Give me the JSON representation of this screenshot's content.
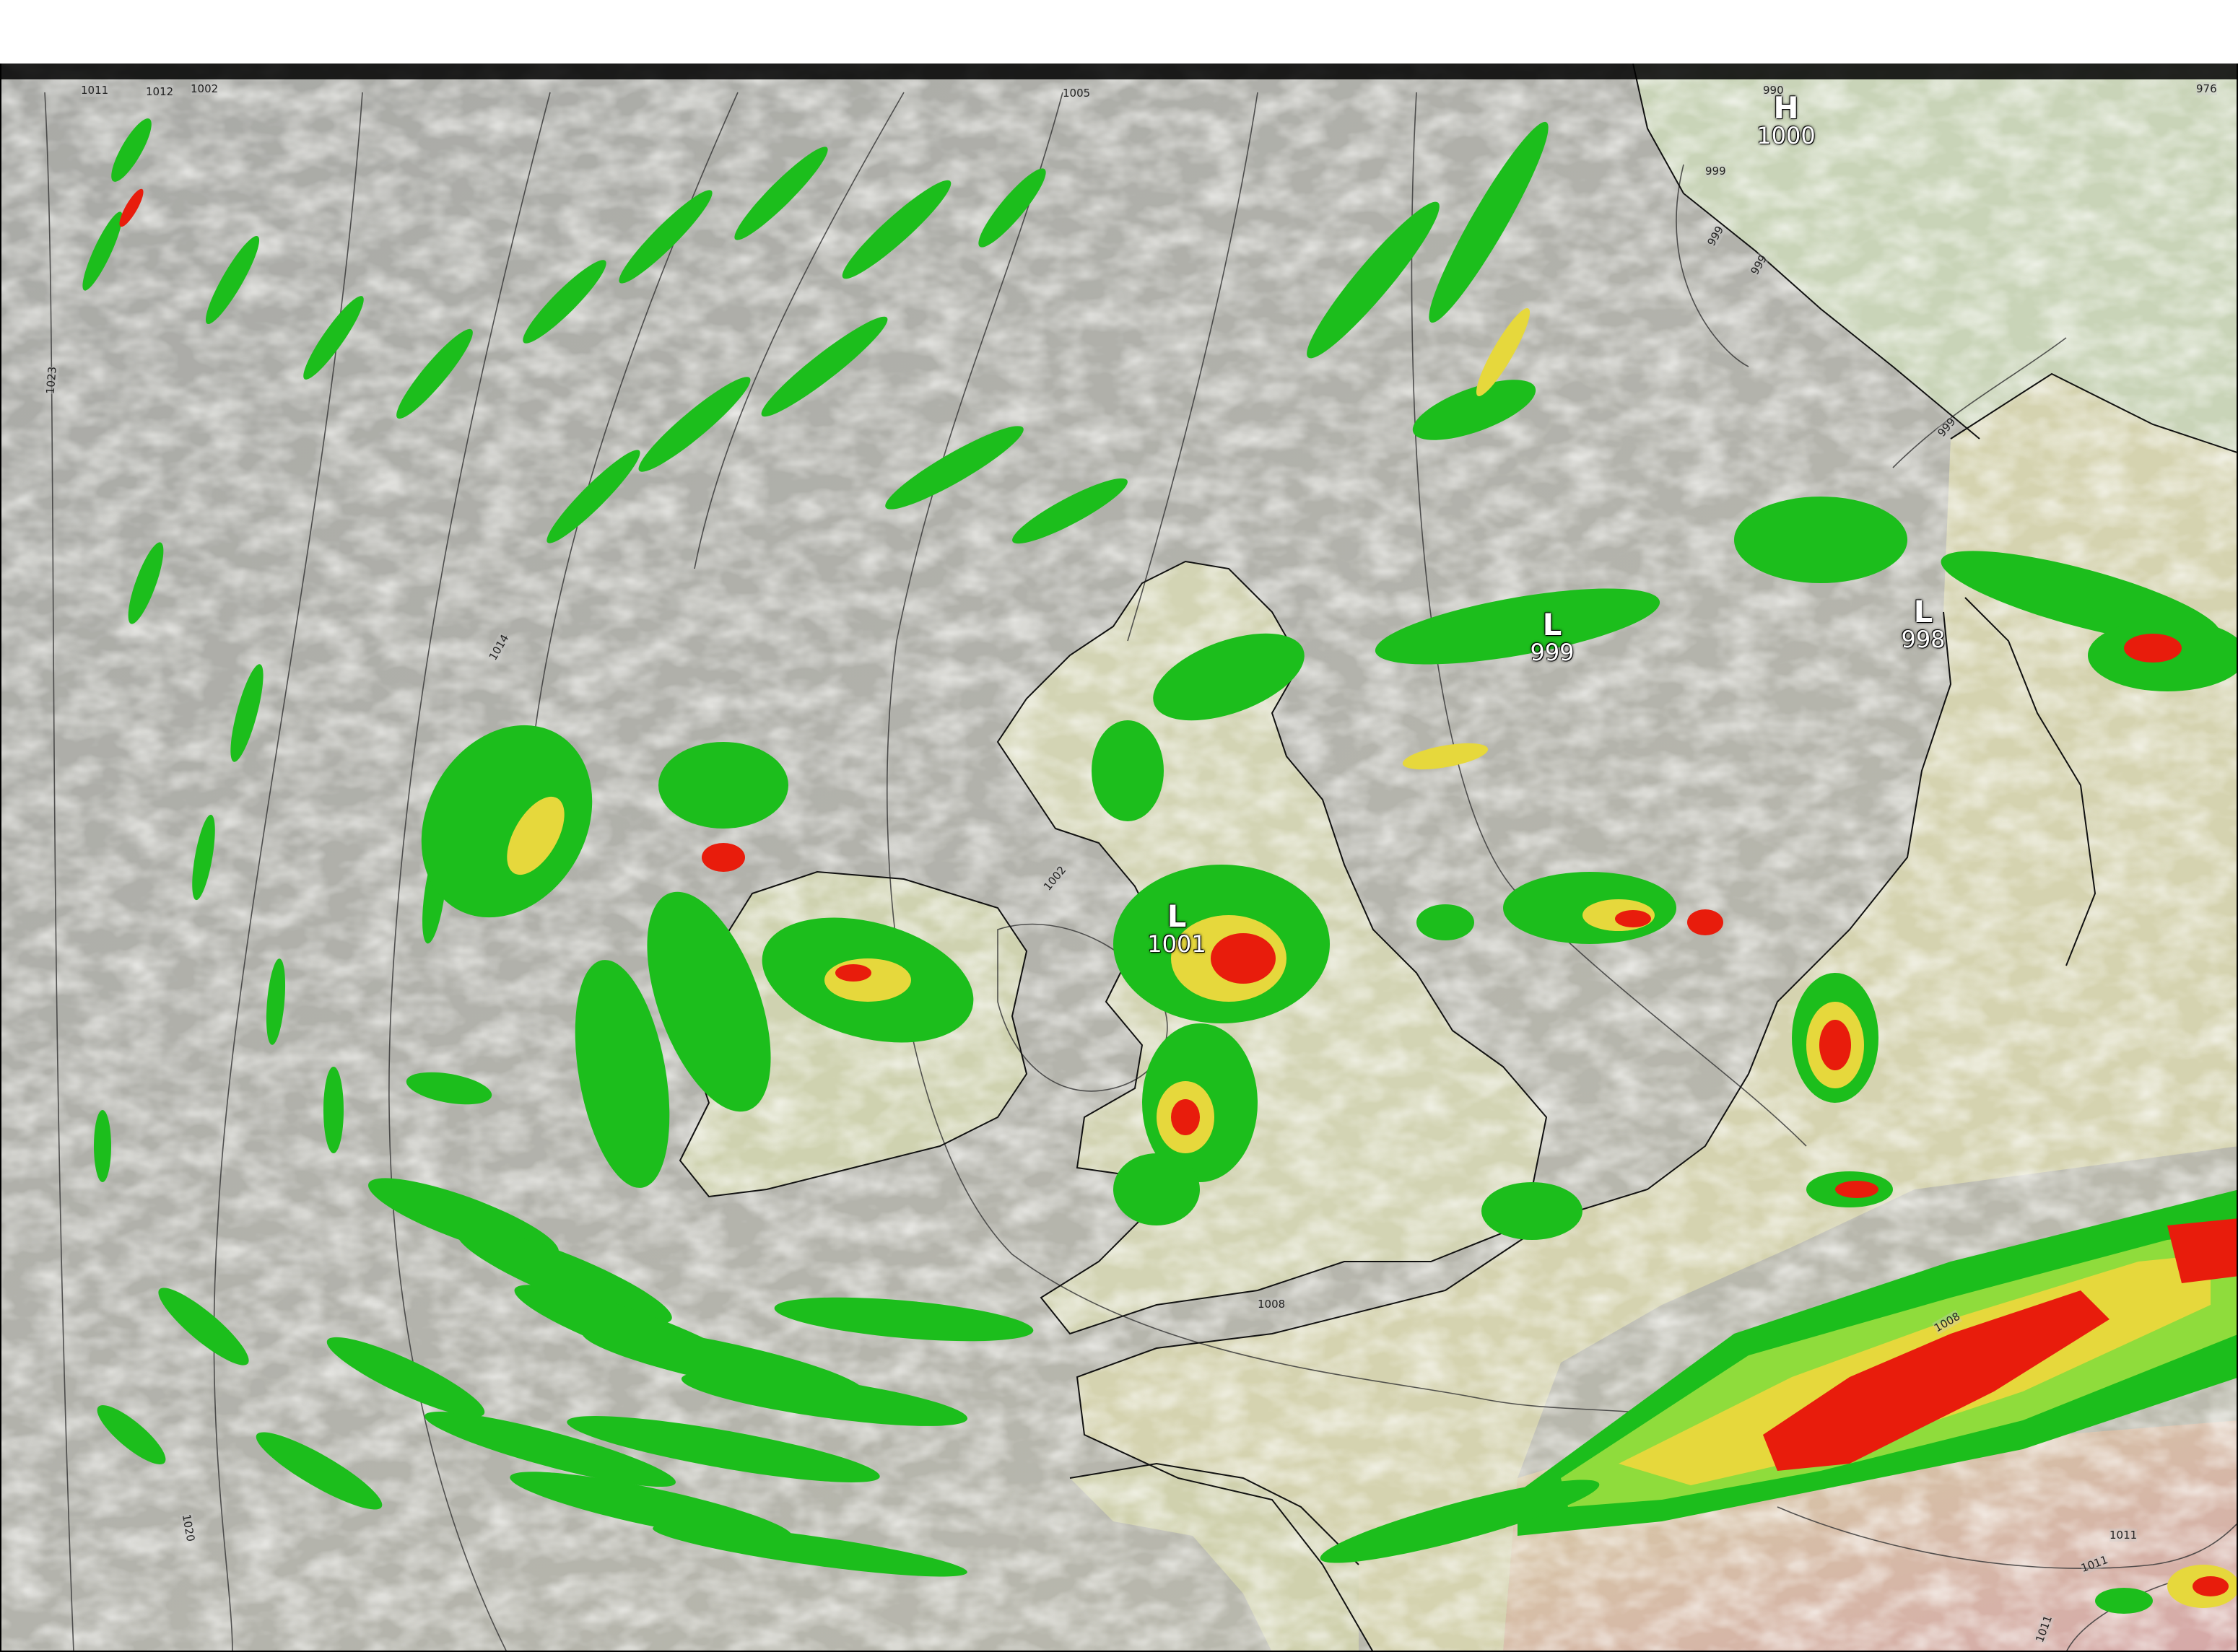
{
  "colors": {
    "ocean_cloud": "#b4b4ae",
    "land": "#d6d6b4",
    "precip_light": "#1cbe1c",
    "precip_mid": "#8fdc3c",
    "precip_moderate": "#e6d83c",
    "precip_heavy": "#e81c0c",
    "isobar": "#3a3a3a",
    "coastline": "#111111"
  },
  "pressure_centers": [
    {
      "symbol": "H",
      "value": "1000"
    },
    {
      "symbol": "L",
      "value": "999"
    },
    {
      "symbol": "L",
      "value": "998"
    },
    {
      "symbol": "L",
      "value": "1001"
    }
  ],
  "isobar_labels": [
    "1023",
    "1014",
    "1020",
    "1008",
    "1008",
    "1011",
    "1011",
    "1011",
    "999",
    "999",
    "999",
    "1002"
  ],
  "top_strip_values": [
    "1011",
    "1012",
    "1002",
    "1005",
    "990",
    "976",
    "999"
  ]
}
